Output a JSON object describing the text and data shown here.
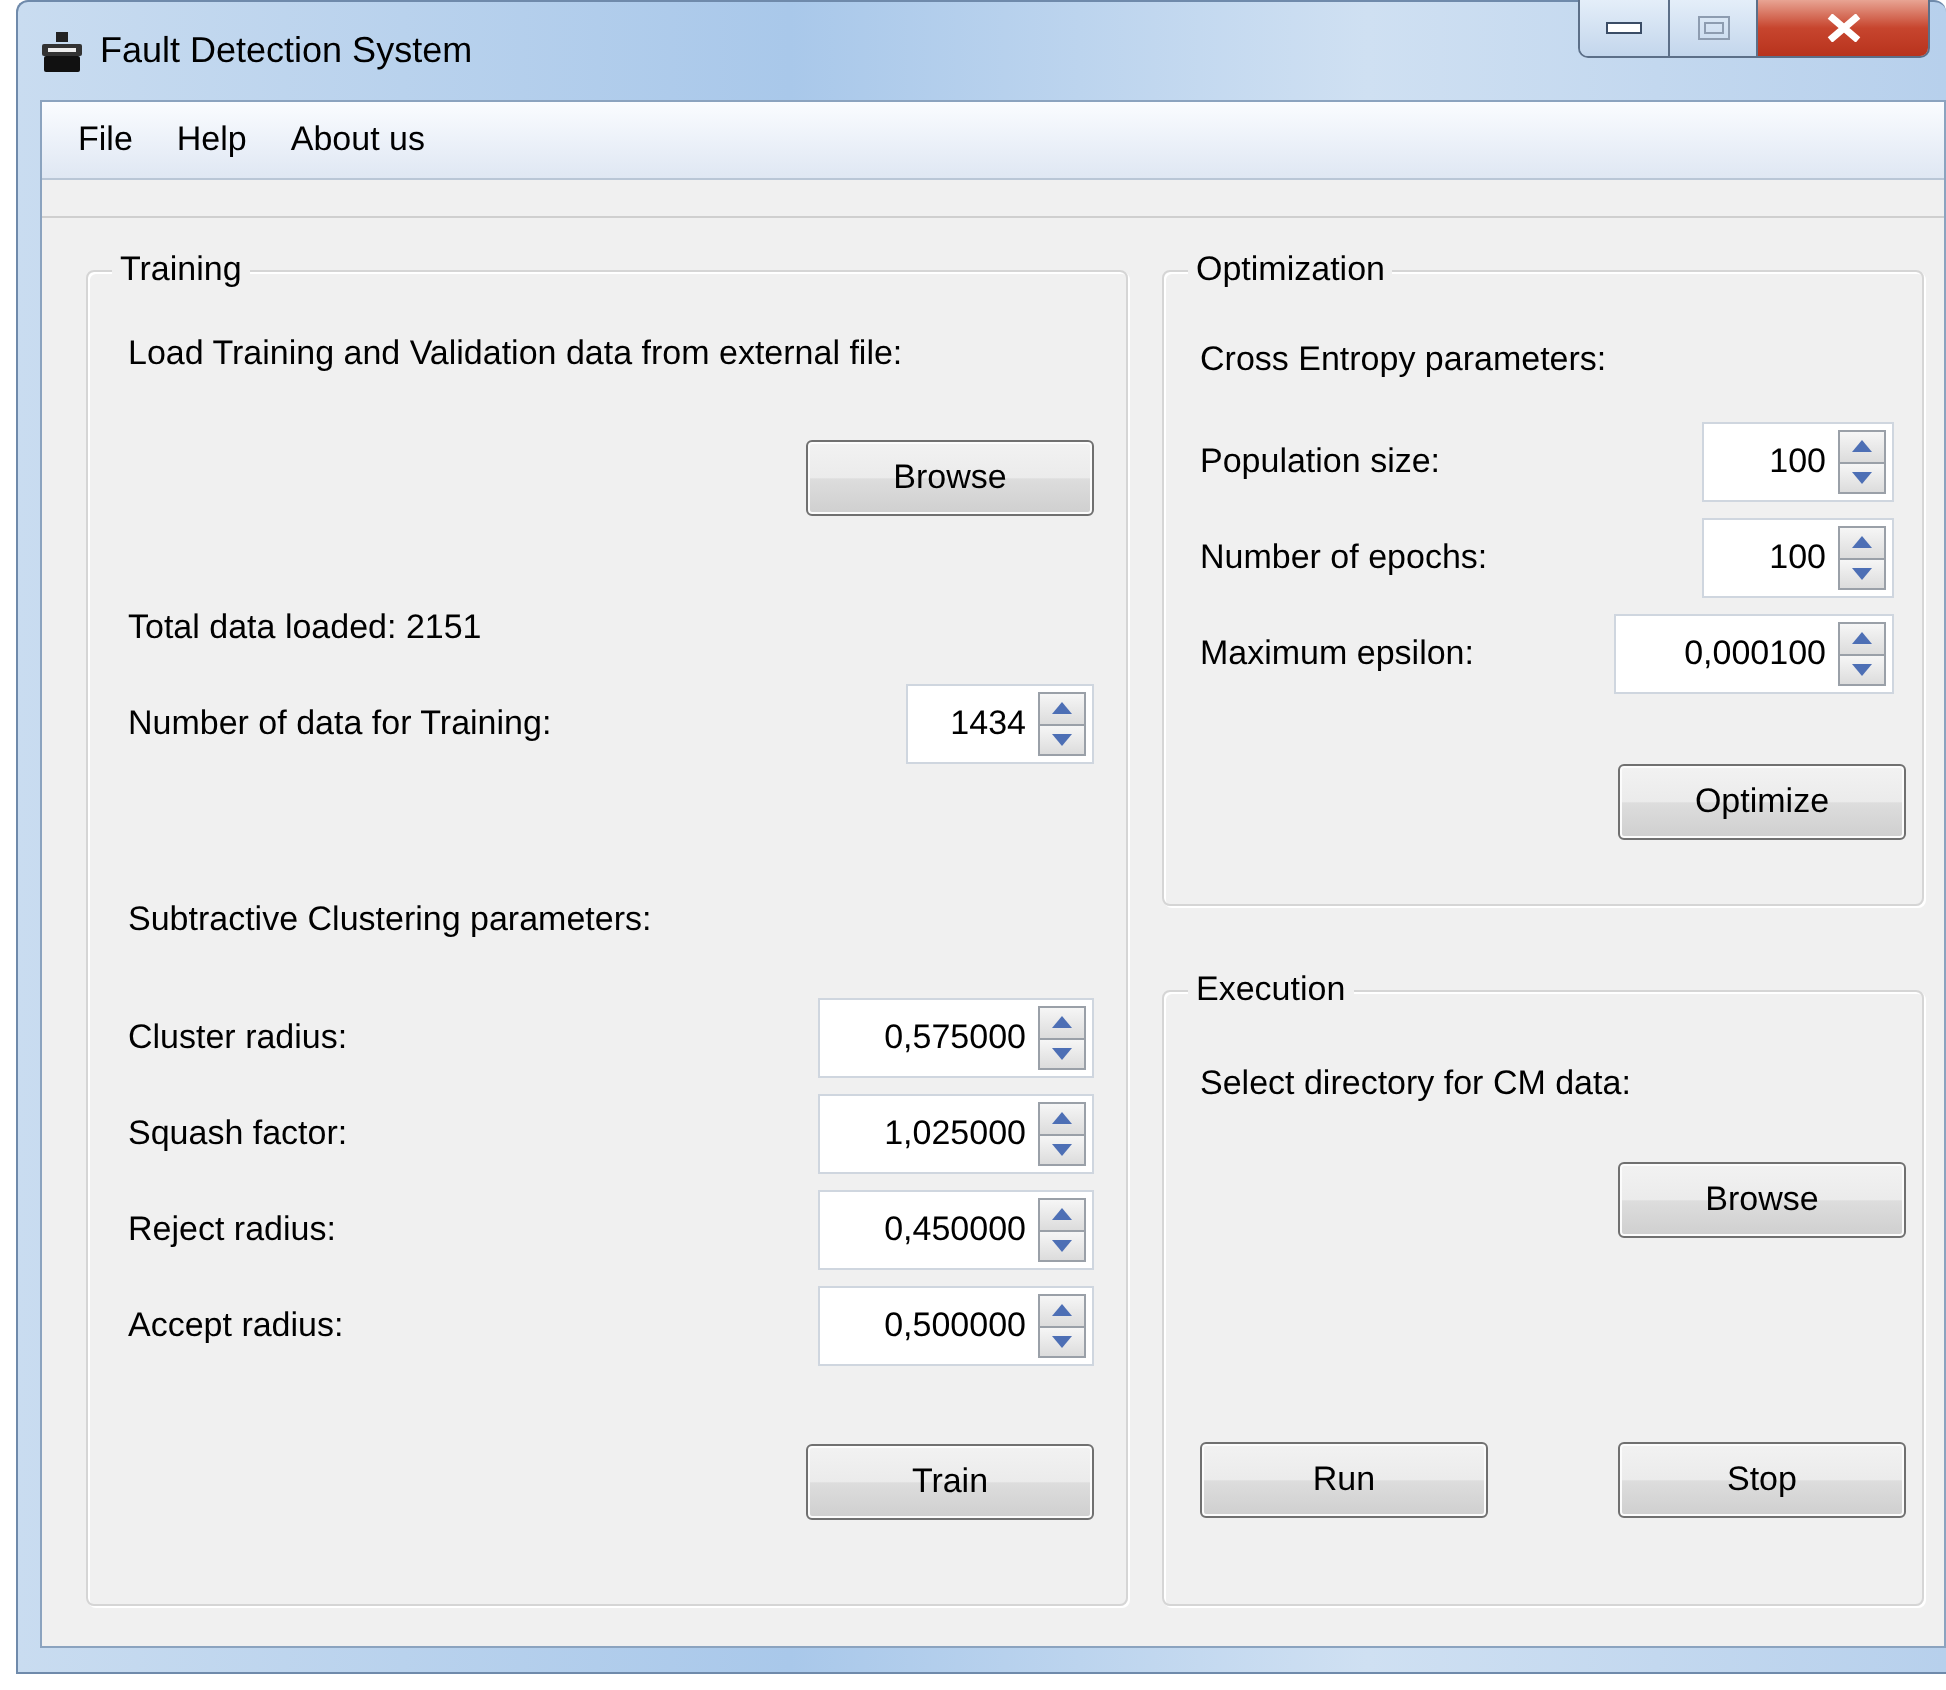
{
  "window": {
    "title": "Fault Detection System"
  },
  "menu": [
    "File",
    "Help",
    "About us"
  ],
  "training": {
    "title": "Training",
    "load_label": "Load Training and Validation data from external file:",
    "browse_button": "Browse",
    "total_loaded": "Total data loaded: 2151",
    "count": {
      "label": "Number of data for Training:",
      "value": "1434"
    },
    "clustering_heading": "Subtractive Clustering parameters:",
    "parameters": [
      {
        "label": "Cluster radius:",
        "value": "0,575000"
      },
      {
        "label": "Squash factor:",
        "value": "1,025000"
      },
      {
        "label": "Reject radius:",
        "value": "0,450000"
      },
      {
        "label": "Accept radius:",
        "value": "0,500000"
      }
    ],
    "train_button": "Train"
  },
  "optimization": {
    "title": "Optimization",
    "heading": "Cross Entropy parameters:",
    "parameters": [
      {
        "label": "Population size:",
        "value": "100"
      },
      {
        "label": "Number of epochs:",
        "value": "100"
      },
      {
        "label": "Maximum epsilon:",
        "value": "0,000100"
      }
    ],
    "optimize_button": "Optimize"
  },
  "execution": {
    "title": "Execution",
    "label": "Select directory for CM data:",
    "browse_button": "Browse",
    "buttons": [
      "Run",
      "Stop"
    ]
  }
}
